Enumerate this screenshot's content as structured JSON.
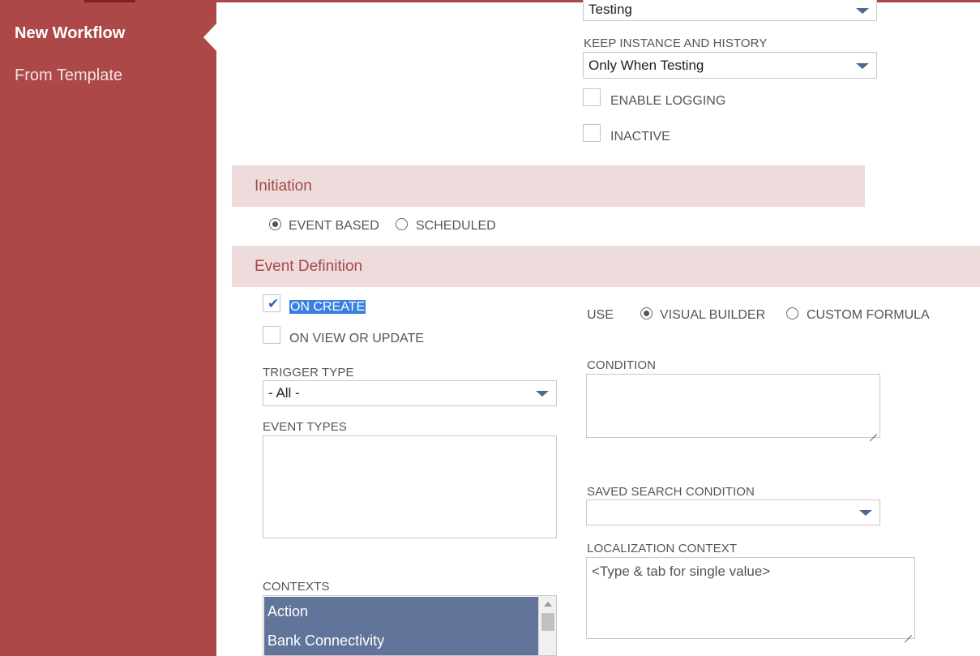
{
  "sidebar": {
    "items": [
      {
        "label": "New Workflow",
        "active": true
      },
      {
        "label": "From Template",
        "active": false
      }
    ]
  },
  "release": {
    "status_value": "Testing"
  },
  "keep_instance": {
    "label": "KEEP INSTANCE AND HISTORY",
    "value": "Only When Testing"
  },
  "enable_logging": {
    "label": "ENABLE LOGGING",
    "checked": false
  },
  "inactive": {
    "label": "INACTIVE",
    "checked": false
  },
  "initiation": {
    "title": "Initiation",
    "options": [
      {
        "label": "EVENT BASED",
        "selected": true
      },
      {
        "label": "SCHEDULED",
        "selected": false
      }
    ]
  },
  "event_definition": {
    "title": "Event Definition",
    "on_create": {
      "label": "ON CREATE",
      "checked": true
    },
    "on_view_update": {
      "label": "ON VIEW OR UPDATE",
      "checked": false
    },
    "use": {
      "label": "USE",
      "options": [
        {
          "label": "VISUAL BUILDER",
          "selected": true
        },
        {
          "label": "CUSTOM FORMULA",
          "selected": false
        }
      ]
    },
    "trigger_type": {
      "label": "TRIGGER TYPE",
      "value": "- All -"
    },
    "condition": {
      "label": "CONDITION",
      "value": ""
    },
    "event_types": {
      "label": "EVENT TYPES"
    },
    "saved_search_condition": {
      "label": "SAVED SEARCH CONDITION",
      "value": ""
    },
    "localization_context": {
      "label": "LOCALIZATION CONTEXT",
      "placeholder": "<Type & tab for single value>"
    },
    "contexts": {
      "label": "CONTEXTS",
      "items": [
        "Action",
        "Bank Connectivity"
      ]
    }
  },
  "colors": {
    "brand": "#ac4848",
    "section_bg": "#eedbdb",
    "list_selected": "#61759a",
    "accent_arrow": "#4b6a92"
  }
}
